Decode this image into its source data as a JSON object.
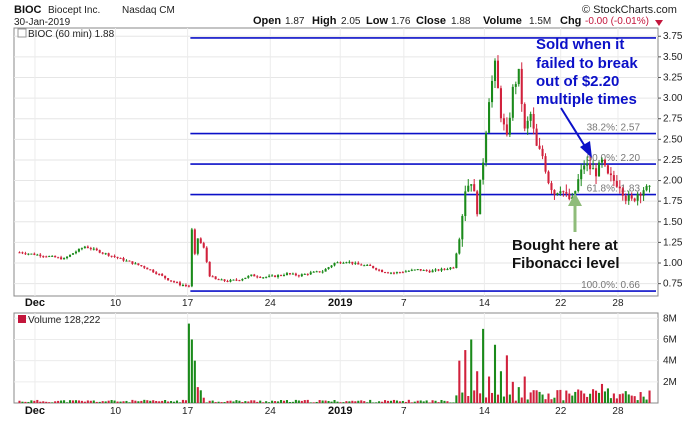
{
  "header": {
    "ticker": "BIOC",
    "company": "Biocept Inc.",
    "exchange": "Nasdaq CM",
    "date": "30-Jan-2019",
    "open_label": "Open",
    "open": "1.87",
    "high_label": "High",
    "high": "2.05",
    "low_label": "Low",
    "low": "1.76",
    "close_label": "Close",
    "close": "1.88",
    "volume_label": "Volume",
    "volume": "1.5M",
    "chg_label": "Chg",
    "chg": "-0.00 (-0.01%)",
    "watermark": "© StockCharts.com"
  },
  "legend": {
    "price": "BIOC (60 min) 1.88",
    "volume": "Volume 128,222"
  },
  "annotations": {
    "sold": [
      "Sold when it",
      "failed to break",
      "out of $2.20",
      "multiple times"
    ],
    "bought": [
      "Bought here at",
      "Fibonacci level"
    ]
  },
  "colors": {
    "up": "#1a8a1a",
    "down": "#d1213c",
    "fib_line": "#0b10c8",
    "annotation_blue": "#0b10c8",
    "arrow_green": "#8fbc7a"
  },
  "chart_data": {
    "type": "candlestick",
    "interval": "60 min",
    "y_ticks": [
      "0.75",
      "1.00",
      "1.25",
      "1.50",
      "1.75",
      "2.00",
      "2.25",
      "2.50",
      "2.75",
      "3.00",
      "3.25",
      "3.50",
      "3.75"
    ],
    "ylim": [
      0.6,
      3.85
    ],
    "x_ticks": [
      "Dec",
      "10",
      "17",
      "24",
      "2019",
      "7",
      "14",
      "22",
      "28"
    ],
    "volume_ticks": [
      "2M",
      "4M",
      "6M",
      "8M"
    ],
    "fib_levels": [
      {
        "label": "",
        "value": 3.73
      },
      {
        "label": "38.2%: 2.57",
        "value": 2.57
      },
      {
        "label": "50.0%: 2.20",
        "value": 2.2
      },
      {
        "label": "61.8%: 1.83",
        "value": 1.83
      },
      {
        "label": "100.0%: 0.66",
        "value": 0.66
      }
    ],
    "price_path": [
      [
        0,
        1.13
      ],
      [
        6,
        1.1
      ],
      [
        10,
        1.08
      ],
      [
        15,
        1.05
      ],
      [
        18,
        1.12
      ],
      [
        22,
        1.2
      ],
      [
        26,
        1.15
      ],
      [
        30,
        1.1
      ],
      [
        34,
        1.05
      ],
      [
        38,
        1.0
      ],
      [
        42,
        0.95
      ],
      [
        46,
        0.88
      ],
      [
        50,
        0.8
      ],
      [
        54,
        0.74
      ],
      [
        57,
        0.72
      ],
      [
        58,
        1.4
      ],
      [
        59,
        1.1
      ],
      [
        60,
        1.3
      ],
      [
        62,
        1.18
      ],
      [
        64,
        0.85
      ],
      [
        66,
        0.8
      ],
      [
        70,
        0.78
      ],
      [
        74,
        0.8
      ],
      [
        78,
        0.85
      ],
      [
        82,
        0.83
      ],
      [
        86,
        0.84
      ],
      [
        90,
        0.87
      ],
      [
        94,
        0.85
      ],
      [
        98,
        0.88
      ],
      [
        102,
        0.9
      ],
      [
        106,
        1.0
      ],
      [
        110,
        1.02
      ],
      [
        114,
        0.98
      ],
      [
        118,
        0.96
      ],
      [
        122,
        0.9
      ],
      [
        126,
        0.88
      ],
      [
        130,
        0.9
      ],
      [
        134,
        0.92
      ],
      [
        138,
        0.9
      ],
      [
        142,
        0.92
      ],
      [
        146,
        0.95
      ],
      [
        148,
        1.3
      ],
      [
        150,
        1.9
      ],
      [
        152,
        2.0
      ],
      [
        154,
        1.65
      ],
      [
        156,
        2.25
      ],
      [
        158,
        3.0
      ],
      [
        160,
        3.4
      ],
      [
        162,
        2.8
      ],
      [
        164,
        2.5
      ],
      [
        166,
        3.1
      ],
      [
        168,
        3.3
      ],
      [
        170,
        2.6
      ],
      [
        172,
        2.8
      ],
      [
        174,
        2.4
      ],
      [
        176,
        2.3
      ],
      [
        178,
        2.0
      ],
      [
        180,
        1.85
      ],
      [
        182,
        1.92
      ],
      [
        184,
        1.8
      ],
      [
        186,
        1.75
      ],
      [
        188,
        2.0
      ],
      [
        190,
        2.2
      ],
      [
        192,
        2.15
      ],
      [
        194,
        2.1
      ],
      [
        196,
        2.22
      ],
      [
        198,
        2.05
      ],
      [
        200,
        2.0
      ],
      [
        202,
        1.95
      ],
      [
        204,
        1.8
      ],
      [
        206,
        1.75
      ],
      [
        208,
        1.85
      ],
      [
        210,
        1.9
      ],
      [
        212,
        1.88
      ]
    ],
    "volume_bars": [
      [
        57,
        7.5
      ],
      [
        58,
        6.0
      ],
      [
        59,
        4.0
      ],
      [
        60,
        1.5
      ],
      [
        61,
        1.2
      ],
      [
        62,
        0.5
      ],
      [
        148,
        4.0
      ],
      [
        150,
        5.0
      ],
      [
        152,
        6.0
      ],
      [
        154,
        3.0
      ],
      [
        156,
        7.0
      ],
      [
        158,
        2.5
      ],
      [
        160,
        5.5
      ],
      [
        162,
        3.0
      ],
      [
        164,
        4.5
      ],
      [
        166,
        2.0
      ],
      [
        168,
        1.5
      ],
      [
        170,
        2.5
      ],
      [
        172,
        1.0
      ],
      [
        174,
        1.2
      ],
      [
        176,
        0.8
      ],
      [
        180,
        0.5
      ],
      [
        186,
        0.7
      ],
      [
        190,
        0.9
      ],
      [
        196,
        1.8
      ],
      [
        200,
        0.9
      ],
      [
        206,
        0.7
      ],
      [
        210,
        0.6
      ]
    ]
  }
}
